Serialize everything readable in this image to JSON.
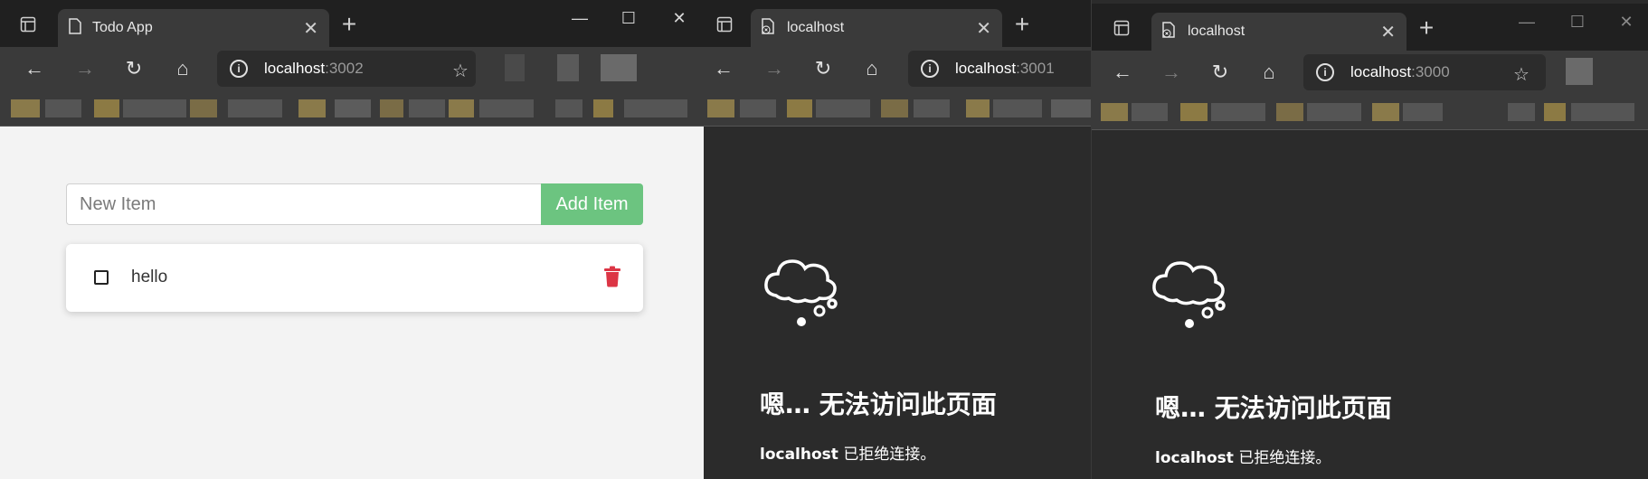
{
  "windows": [
    {
      "tab_title": "Todo App",
      "address_host": "localhost",
      "address_port": ":3002",
      "app": {
        "input_placeholder": "New Item",
        "add_button_label": "Add Item",
        "items": [
          {
            "text": "hello",
            "completed": false
          }
        ]
      }
    },
    {
      "tab_title": "localhost",
      "address_host": "localhost",
      "address_port": ":3001",
      "error": {
        "title": "嗯… 无法访问此页面",
        "host": "localhost",
        "message": " 已拒绝连接。"
      }
    },
    {
      "tab_title": "localhost",
      "address_host": "localhost",
      "address_port": ":3000",
      "error": {
        "title": "嗯… 无法访问此页面",
        "host": "localhost",
        "message": " 已拒绝连接。"
      }
    }
  ],
  "colors": {
    "add_button": "#6cc480",
    "trash_icon": "#dc3545",
    "browser_frame": "#202020",
    "toolbar": "#3a3a3a",
    "error_bg": "#2b2b2b"
  },
  "icons": {
    "tab_actions": "tab-actions-icon",
    "page": "page-icon",
    "error_page": "error-page-icon",
    "back": "back-arrow-icon",
    "forward": "forward-arrow-icon",
    "refresh": "refresh-icon",
    "home": "home-icon",
    "info": "info-icon",
    "favorite": "favorite-star-icon",
    "trash": "trash-icon",
    "cloud": "thought-cloud-icon"
  }
}
